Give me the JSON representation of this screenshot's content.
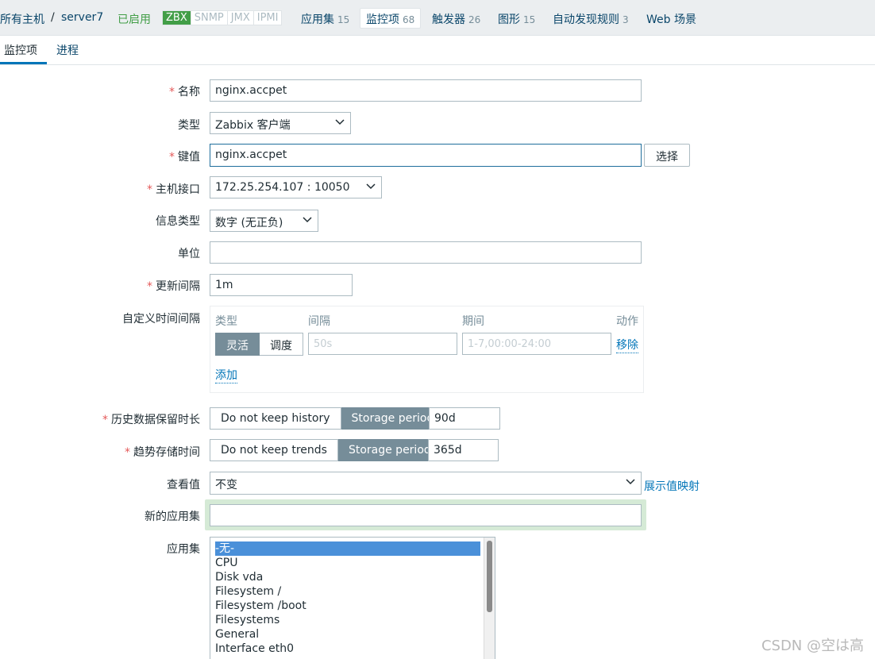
{
  "hostnav": {
    "all_hosts": "所有主机",
    "separator": "/",
    "host": "server7",
    "enabled": "已启用",
    "status": [
      "ZBX",
      "SNMP",
      "JMX",
      "IPMI"
    ],
    "tabs": [
      {
        "label": "应用集",
        "count": "15"
      },
      {
        "label": "监控项",
        "count": "68"
      },
      {
        "label": "触发器",
        "count": "26"
      },
      {
        "label": "图形",
        "count": "15"
      },
      {
        "label": "自动发现规则",
        "count": "3"
      },
      {
        "label": "Web 场景",
        "count": ""
      }
    ]
  },
  "subtabs": {
    "items": "监控项",
    "processes": "进程"
  },
  "form": {
    "name_label": "名称",
    "name_value": "nginx.accpet",
    "type_label": "类型",
    "type_value": "Zabbix 客户端",
    "key_label": "键值",
    "key_value": "nginx.accpet",
    "key_button": "选择",
    "interface_label": "主机接口",
    "interface_value": "172.25.254.107 : 10050",
    "info_type_label": "信息类型",
    "info_type_value": "数字 (无正负)",
    "units_label": "单位",
    "units_value": "",
    "interval_label": "更新间隔",
    "interval_value": "1m",
    "custom_label": "自定义时间间隔",
    "custom": {
      "col_type": "类型",
      "col_interval": "间隔",
      "col_period": "期间",
      "col_action": "动作",
      "flexible": "灵活",
      "scheduling": "调度",
      "interval_placeholder": "50s",
      "period_placeholder": "1-7,00:00-24:00",
      "remove": "移除",
      "add": "添加"
    },
    "history_label": "历史数据保留时长",
    "history_opt1": "Do not keep history",
    "history_opt2": "Storage period",
    "history_value": "90d",
    "trends_label": "趋势存储时间",
    "trends_opt1": "Do not keep trends",
    "trends_opt2": "Storage period",
    "trends_value": "365d",
    "valuemap_label": "查看值",
    "valuemap_value": "不变",
    "valuemap_link": "展示值映射",
    "new_app_label": "新的应用集",
    "new_app_value": "",
    "apps_label": "应用集",
    "apps": [
      "-无-",
      "CPU",
      "Disk vda",
      "Filesystem /",
      "Filesystem /boot",
      "Filesystems",
      "General",
      "Interface eth0"
    ]
  },
  "watermark": "CSDN @空は高"
}
